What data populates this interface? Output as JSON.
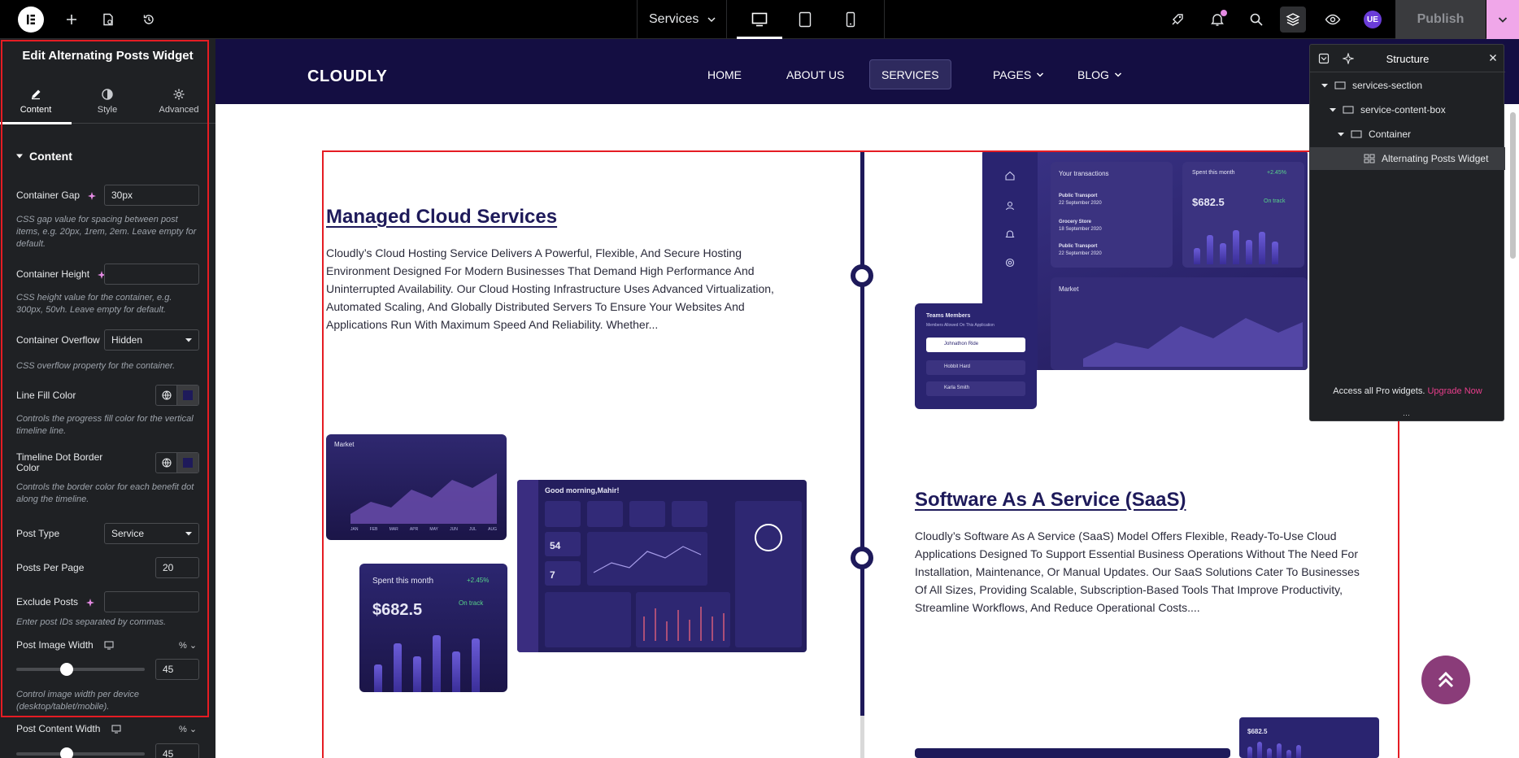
{
  "topbar": {
    "page_name": "Services",
    "publish_label": "Publish",
    "user_initials": "UE"
  },
  "panel": {
    "title": "Edit Alternating Posts Widget",
    "tabs": [
      {
        "label": "Content",
        "icon": "pencil-icon"
      },
      {
        "label": "Style",
        "icon": "contrast-icon"
      },
      {
        "label": "Advanced",
        "icon": "gear-icon"
      }
    ],
    "section_title": "Content",
    "fields": {
      "container_gap": {
        "label": "Container Gap",
        "value": "30px",
        "help": "CSS gap value for spacing between post items, e.g. 20px, 1rem, 2em. Leave empty for default."
      },
      "container_height": {
        "label": "Container Height",
        "value": "",
        "help": "CSS height value for the container, e.g. 300px, 50vh. Leave empty for default."
      },
      "container_overflow": {
        "label": "Container Overflow",
        "value": "Hidden",
        "help": "CSS overflow property for the container."
      },
      "line_fill_color": {
        "label": "Line Fill Color",
        "help": "Controls the progress fill color for the vertical timeline line.",
        "color": "#1e1a5a"
      },
      "timeline_dot_border": {
        "label": "Timeline Dot Border Color",
        "help": "Controls the border color for each benefit dot along the timeline.",
        "color": "#1e1a5a"
      },
      "post_type": {
        "label": "Post Type",
        "value": "Service"
      },
      "posts_per_page": {
        "label": "Posts Per Page",
        "value": "20"
      },
      "exclude_posts": {
        "label": "Exclude Posts",
        "value": "",
        "help": "Enter post IDs separated by commas."
      },
      "post_image_width": {
        "label": "Post Image Width",
        "unit": "%",
        "value": "45",
        "help": "Control image width per device (desktop/tablet/mobile)."
      },
      "post_content_width": {
        "label": "Post Content Width",
        "unit": "%",
        "value": "45"
      }
    }
  },
  "site": {
    "logo": "CLOUDLY",
    "nav": [
      {
        "label": "HOME"
      },
      {
        "label": "ABOUT US"
      },
      {
        "label": "SERVICES"
      },
      {
        "label": "PAGES"
      },
      {
        "label": "BLOG"
      }
    ],
    "posts": [
      {
        "title": "Managed Cloud Services",
        "excerpt": "Cloudly’s Cloud Hosting Service Delivers A Powerful, Flexible, And Secure Hosting Environment Designed For Modern Businesses That Demand High Performance And Uninterrupted Availability. Our Cloud Hosting Infrastructure Uses Advanced Virtualization, Automated Scaling, And Globally Distributed Servers To Ensure Your Websites And Applications Run With Maximum Speed And Reliability. Whether..."
      },
      {
        "title": "Software As A Service (SaaS)",
        "excerpt": "Cloudly’s Software As A Service (SaaS) Model Offers Flexible, Ready-To-Use Cloud Applications Designed To Support Essential Business Operations Without The Need For Installation, Maintenance, Or Manual Updates. Our SaaS Solutions Cater To Businesses Of All Sizes, Providing Scalable, Subscription-Based Tools That Improve Productivity, Streamline Workflows, And Reduce Operational Costs...."
      }
    ],
    "mock1": {
      "transactions_title": "Your transactions",
      "tx": [
        {
          "name": "Public Transport",
          "date": "22 September 2020"
        },
        {
          "name": "Grocery Store",
          "date": "18 September 2020"
        },
        {
          "name": "Public Transport",
          "date": "22 September 2020"
        }
      ],
      "spent_label": "Spent this month",
      "spent_value": "$682.5",
      "spent_change": "+2.45%",
      "on_track": "On track",
      "market_label": "Market",
      "team_title": "Teams Members",
      "team_sub": "Members Allowed On This Application",
      "members": [
        "Johnathon Ride",
        "Hobbit Hard",
        "Karla Smith"
      ]
    },
    "mock2": {
      "market_label": "Market",
      "months": [
        "JAN",
        "FEB",
        "MAR",
        "APR",
        "MAY",
        "JUN",
        "JUL",
        "AUG"
      ],
      "greeting": "Good morning,Mahir!",
      "spent_label": "Spent this month",
      "spent_value": "$682.5",
      "spent_change": "+2.45%",
      "on_track": "On track",
      "stat1": "54",
      "stat2": "7"
    },
    "mock3": {
      "spent_value": "$682.5"
    }
  },
  "structure": {
    "title": "Structure",
    "items": [
      {
        "label": "services-section"
      },
      {
        "label": "service-content-box"
      },
      {
        "label": "Container"
      },
      {
        "label": "Alternating Posts Widget"
      }
    ],
    "footer_text": "Access all Pro widgets.",
    "footer_link": "Upgrade Now"
  }
}
